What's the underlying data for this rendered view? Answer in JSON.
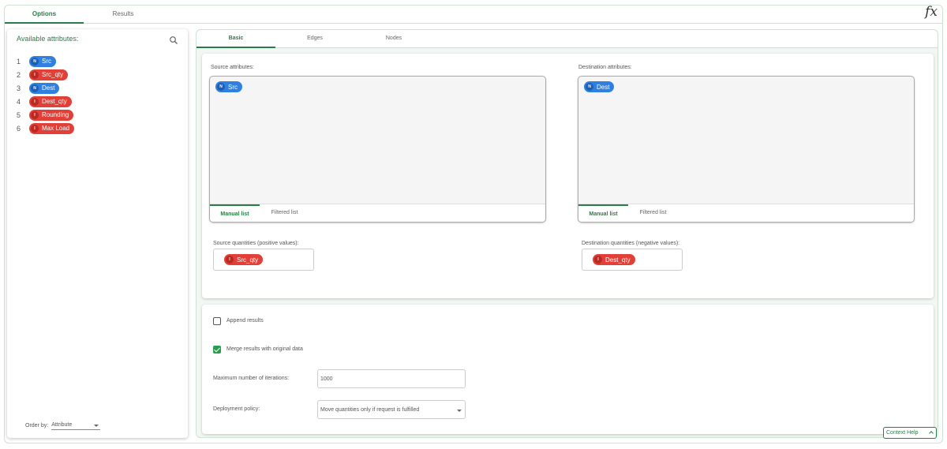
{
  "top_tabs": [
    "Options",
    "Results"
  ],
  "fx_label": "fx",
  "left": {
    "title": "Available attributes:",
    "search_icon": "search-icon",
    "attributes": [
      {
        "n": "1",
        "tag": "N",
        "label": "Src",
        "color": "#2f80e0"
      },
      {
        "n": "2",
        "tag": "I",
        "label": "Src_qty",
        "color": "#e04037"
      },
      {
        "n": "3",
        "tag": "N",
        "label": "Dest",
        "color": "#2f80e0"
      },
      {
        "n": "4",
        "tag": "I",
        "label": "Dest_qty",
        "color": "#e04037"
      },
      {
        "n": "5",
        "tag": "I",
        "label": "Rounding",
        "color": "#e04037"
      },
      {
        "n": "6",
        "tag": "I",
        "label": "Max Load",
        "color": "#e04037"
      }
    ],
    "order_by_label": "Order by:",
    "order_by_value": "Attribute"
  },
  "sub_tabs": [
    "Basic",
    "Edges",
    "Nodes"
  ],
  "source": {
    "label": "Source attributes:",
    "chip_tag": "N",
    "chip_label": "Src",
    "tabs": [
      "Manual list",
      "Filtered list"
    ]
  },
  "destination": {
    "label": "Destination attributes:",
    "chip_tag": "N",
    "chip_label": "Dest",
    "tabs": [
      "Manual list",
      "Filtered list"
    ]
  },
  "source_qty": {
    "label": "Source quantities (positive values):",
    "chip_tag": "I",
    "chip_label": "Src_qty"
  },
  "dest_qty": {
    "label": "Destination quantities (negative values):",
    "chip_tag": "I",
    "chip_label": "Dest_qty"
  },
  "options": {
    "append_label": "Append results",
    "append_checked": false,
    "merge_label": "Merge results with original data",
    "merge_checked": true,
    "max_iter_label": "Maximum number of iterations:",
    "max_iter_value": "1000",
    "policy_label": "Deployment policy:",
    "policy_value": "Move quantities only if request is fulfilled"
  },
  "context_help": "Context Help",
  "colors": {
    "accent": "#2a7d46",
    "nominal": "#2f80e0",
    "integer": "#e04037"
  }
}
